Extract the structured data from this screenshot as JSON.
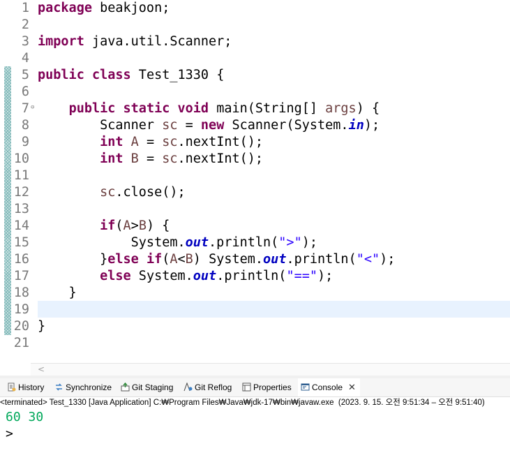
{
  "editor": {
    "current_line": 19,
    "lines": [
      {
        "n": "1",
        "html": "<span class='kw'>package</span> beakjoon;"
      },
      {
        "n": "2",
        "html": ""
      },
      {
        "n": "3",
        "html": "<span class='kw'>import</span> java.util.Scanner;"
      },
      {
        "n": "4",
        "html": ""
      },
      {
        "n": "5",
        "html": "<span class='kw'>public</span> <span class='kw'>class</span> Test_1330 {"
      },
      {
        "n": "6",
        "html": ""
      },
      {
        "n": "7",
        "html": "    <span class='kw'>public</span> <span class='kw'>static</span> <span class='kw'>void</span> main(String[] <span class='var'>args</span>) {",
        "fold": "⊖"
      },
      {
        "n": "8",
        "html": "        Scanner <span class='var'>sc</span> = <span class='kw'>new</span> Scanner(System.<span class='fld'>in</span>);"
      },
      {
        "n": "9",
        "html": "        <span class='kw'>int</span> <span class='var'>A</span> = <span class='var'>sc</span>.nextInt();"
      },
      {
        "n": "10",
        "html": "        <span class='kw'>int</span> <span class='var'>B</span> = <span class='var'>sc</span>.nextInt();"
      },
      {
        "n": "11",
        "html": ""
      },
      {
        "n": "12",
        "html": "        <span class='var'>sc</span>.close();"
      },
      {
        "n": "13",
        "html": ""
      },
      {
        "n": "14",
        "html": "        <span class='kw'>if</span>(<span class='var'>A</span>&gt;<span class='var'>B</span>) {"
      },
      {
        "n": "15",
        "html": "            System.<span class='fld'>out</span>.println(<span class='str'>\"&gt;\"</span>);"
      },
      {
        "n": "16",
        "html": "        }<span class='kw'>else</span> <span class='kw'>if</span>(<span class='var'>A</span>&lt;<span class='var'>B</span>) System.<span class='fld'>out</span>.println(<span class='str'>\"&lt;\"</span>);"
      },
      {
        "n": "17",
        "html": "        <span class='kw'>else</span> System.<span class='fld'>out</span>.println(<span class='str'>\"==\"</span>);"
      },
      {
        "n": "18",
        "html": "    }"
      },
      {
        "n": "19",
        "html": ""
      },
      {
        "n": "20",
        "html": "}"
      },
      {
        "n": "21",
        "html": ""
      }
    ]
  },
  "scroll_left_glyph": "<",
  "views": {
    "tabs": [
      {
        "label": "History",
        "icon": "history-icon"
      },
      {
        "label": "Synchronize",
        "icon": "synchronize-icon"
      },
      {
        "label": "Git Staging",
        "icon": "git-staging-icon"
      },
      {
        "label": "Git Reflog",
        "icon": "git-reflog-icon"
      },
      {
        "label": "Properties",
        "icon": "properties-icon"
      },
      {
        "label": "Console",
        "icon": "console-icon",
        "active": true
      }
    ],
    "close_glyph": "✕"
  },
  "console": {
    "status": "<terminated> Test_1330 [Java Application] C:₩Program Files₩Java₩jdk-17₩bin₩javaw.exe  (2023. 9. 15. 오전 9:51:34 – 오전 9:51:40)",
    "output_line": "60 30",
    "prompt": ">"
  },
  "colors": {
    "keyword": "#7f0055",
    "variable": "#6a3e3e",
    "field": "#0000c0",
    "string": "#2a00ff",
    "console_input": "#00a85a",
    "current_line_bg": "#e8f2fe"
  }
}
